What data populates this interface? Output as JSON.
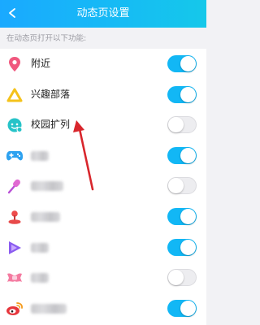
{
  "header": {
    "title": "动态页设置",
    "back_icon": "back-arrow-icon",
    "colors": [
      "#1aa9ff",
      "#15c8ea"
    ]
  },
  "section": {
    "label": "在动态页打开以下功能:"
  },
  "accent_color": "#12b7f5",
  "annotation_color": "#d8262c",
  "rows": [
    {
      "label": "附近",
      "icon": "location-pin-icon",
      "enabled": true
    },
    {
      "label": "兴趣部落",
      "icon": "tribe-triangle-icon",
      "enabled": true
    },
    {
      "label": "校园扩列",
      "icon": "campus-face-icon",
      "enabled": false
    },
    {
      "label": "",
      "icon": "game-controller-icon",
      "enabled": true
    },
    {
      "label": "",
      "icon": "microphone-icon",
      "enabled": false
    },
    {
      "label": "",
      "icon": "joystick-icon",
      "enabled": true
    },
    {
      "label": "",
      "icon": "play-video-icon",
      "enabled": true
    },
    {
      "label": "",
      "icon": "pink-ribbon-icon",
      "enabled": false
    },
    {
      "label": "",
      "icon": "weibo-icon",
      "enabled": true
    }
  ]
}
